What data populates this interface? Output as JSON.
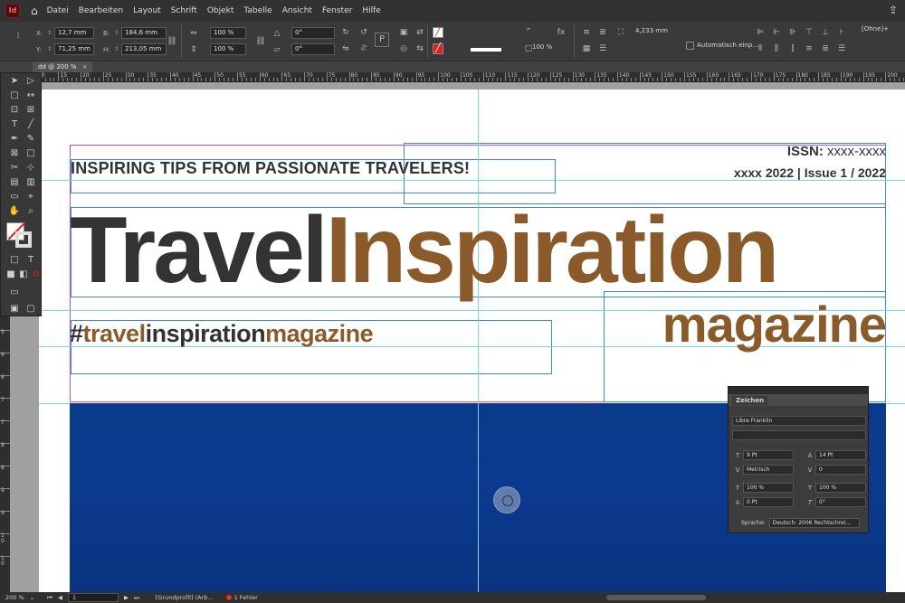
{
  "app": {
    "logo_text": "Id"
  },
  "menu": {
    "items": [
      "Datei",
      "Bearbeiten",
      "Layout",
      "Schrift",
      "Objekt",
      "Tabelle",
      "Ansicht",
      "Fenster",
      "Hilfe"
    ]
  },
  "control_panel": {
    "x_label": "X:",
    "x_value": "12,7 mm",
    "y_label": "Y:",
    "y_value": "71,25 mm",
    "b_label": "B:",
    "b_value": "184,6 mm",
    "h_label": "H:",
    "h_value": "213,05 mm",
    "scale_x": "100 %",
    "scale_y": "100 %",
    "rotate": "0°",
    "shear": "0°",
    "stroke_weight": "",
    "opacity": "100 %",
    "stroke_width": "4,233 mm",
    "auto_fit": "Automatisch einp...",
    "style": "[Ohne]+"
  },
  "tab": {
    "title": "dd @ 200 %"
  },
  "ruler": {
    "h_numbers": [
      "5",
      "10",
      "15",
      "20",
      "25",
      "30",
      "35",
      "40",
      "45",
      "50",
      "55",
      "60",
      "65",
      "70",
      "75",
      "80",
      "85",
      "90",
      "95",
      "100",
      "105",
      "110",
      "115",
      "120",
      "125",
      "130",
      "135",
      "140",
      "145",
      "150",
      "155",
      "160",
      "165",
      "170",
      "175",
      "180",
      "185",
      "190",
      "195",
      "200",
      "205"
    ],
    "v_numbers": [
      "5",
      "6",
      "6",
      "7",
      "7",
      "8",
      "8",
      "9",
      "9",
      "10",
      "10"
    ]
  },
  "document": {
    "issn_label": "ISSN:",
    "issn_value": "xxxx-xxxx",
    "issue": "xxxx 2022 | Issue 1 / 2022",
    "tagline": "INSPIRING TIPS FROM PASSIONATE TRAVELERS!",
    "title_part1": "Travel",
    "title_part2": "Inspiration",
    "subtitle": "magazine",
    "hashtag_hash": "#",
    "hashtag_travel": "travel",
    "hashtag_inspiration": "inspiration",
    "hashtag_magazine": "magazine"
  },
  "character_panel": {
    "title": "Zeichen",
    "font_family": "Libre Franklin",
    "font_style": "",
    "font_size": "9 Pt",
    "leading": "14 Pt",
    "kerning": "Metrisch",
    "tracking": "0",
    "vertical_scale": "100 %",
    "horizontal_scale": "100 %",
    "baseline_shift": "0 Pt",
    "skew": "0°",
    "language_label": "Sprache:",
    "language_value": "Deutsch: 2006 Rechtschrei..."
  },
  "status": {
    "zoom": "200 %",
    "page": "1",
    "profile": "[Grundprofil] (Arb...",
    "errors": "1 Fehler"
  },
  "colors": {
    "brand_brown": "#8b5a2b",
    "text_dark": "#333333",
    "photo_blue": "#0c3a8a",
    "guide_cyan": "#6fd9e8",
    "frame_blue": "#3a8be0",
    "margin_magenta": "#c050c8"
  }
}
